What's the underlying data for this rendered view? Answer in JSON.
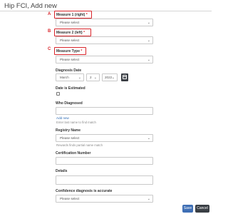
{
  "page": {
    "title": "Hip FCI, Add new"
  },
  "annotations": {
    "a": "A",
    "b": "B",
    "c": "C"
  },
  "fields": {
    "measure1": {
      "label": "Measure 1 (right)",
      "required_mark": "*",
      "value": "Please select"
    },
    "measure2": {
      "label": "Measure 2 (left)",
      "required_mark": "*",
      "value": "Please select"
    },
    "measure_type": {
      "label": "Measure Type",
      "required_mark": "*",
      "value": "Please select"
    },
    "diagnosis_date": {
      "label": "Diagnosis Date",
      "month": "March",
      "day": "2",
      "year": "2022"
    },
    "date_estimated": {
      "label": "Date is Estimated",
      "checked": false
    },
    "who_diagnosed": {
      "label": "Who Diagnosed",
      "value": "",
      "add_new": "Add new",
      "hint": "Enter last name to find match"
    },
    "registry_name": {
      "label": "Registry Name",
      "value": "Please select",
      "hint": "Rewards finds partial name match"
    },
    "certification_number": {
      "label": "Certification Number",
      "value": ""
    },
    "details": {
      "label": "Details",
      "value": ""
    },
    "confidence": {
      "label": "Confidence diagnosis is accurate",
      "value": "Please select"
    }
  },
  "buttons": {
    "save": "Save",
    "cancel": "Cancel"
  },
  "colors": {
    "accent_red": "#d9252b",
    "save_blue": "#3f6fb5",
    "cancel_dark": "#3a3f45",
    "link_blue": "#2d6bb5"
  },
  "icons": {
    "dropdown": "chevron-down-icon",
    "calendar": "calendar-icon"
  }
}
